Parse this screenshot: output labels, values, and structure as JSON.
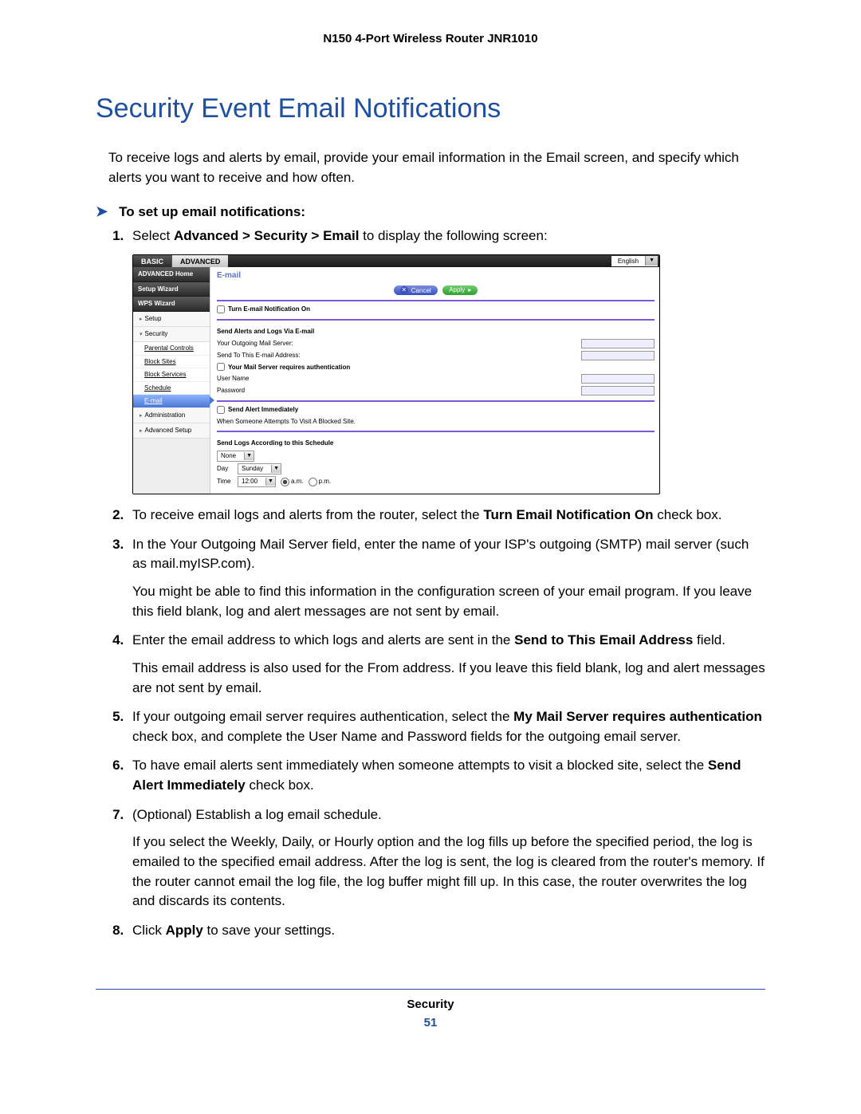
{
  "header": {
    "product": "N150 4-Port Wireless Router JNR1010"
  },
  "title": "Security Event Email Notifications",
  "intro": "To receive logs and alerts by email, provide your email information in the Email screen, and specify which alerts you want to receive and how often.",
  "howto": "To set up email notifications:",
  "steps": {
    "s1_a": "Select ",
    "s1_b": "Advanced > Security > Email",
    "s1_c": " to display the following screen:",
    "s2_a": "To receive email logs and alerts from the router, select the ",
    "s2_b": "Turn Email Notification On",
    "s2_c": " check box.",
    "s3": "In the Your Outgoing Mail Server field, enter the name of your ISP's outgoing (SMTP) mail server (such as mail.myISP.com).",
    "s3_p": "You might be able to find this information in the configuration screen of your email program. If you leave this field blank, log and alert messages are not sent by email.",
    "s4_a": "Enter the email address to which logs and alerts are sent in the ",
    "s4_b": "Send to This Email Address",
    "s4_c": " field.",
    "s4_p": "This email address is also used for the From address. If you leave this field blank, log and alert messages are not sent by email.",
    "s5_a": "If your outgoing email server requires authentication, select the ",
    "s5_b": "My Mail Server requires authentication",
    "s5_c": " check box, and complete the User Name and Password fields for the outgoing email server.",
    "s6_a": "To have email alerts sent immediately when someone attempts to visit a blocked site, select the ",
    "s6_b": "Send Alert Immediately",
    "s6_c": " check box.",
    "s7": "(Optional) Establish a log email schedule.",
    "s7_p": "If you select the Weekly, Daily, or Hourly option and the log fills up before the specified period, the log is emailed to the specified email address. After the log is sent, the log is cleared from the router's memory. If the router cannot email the log file, the log buffer might fill up. In this case, the router overwrites the log and discards its contents.",
    "s8_a": "Click ",
    "s8_b": "Apply",
    "s8_c": " to save your settings."
  },
  "ui": {
    "tabs": {
      "basic": "BASIC",
      "advanced": "ADVANCED"
    },
    "lang": "English",
    "sidebar": {
      "adv_home": "ADVANCED Home",
      "setup_wizard": "Setup Wizard",
      "wps_wizard": "WPS Wizard",
      "setup": "Setup",
      "security": "Security",
      "subs": {
        "parental": "Parental Controls",
        "block_sites": "Block Sites",
        "block_services": "Block Services",
        "schedule": "Schedule",
        "email": "E-mail"
      },
      "admin": "Administration",
      "adv_setup": "Advanced Setup"
    },
    "main": {
      "title": "E-mail",
      "cancel": "Cancel",
      "apply": "Apply",
      "notif_on": "Turn E-mail Notification On",
      "sec_alerts": "Send Alerts and Logs Via E-mail",
      "outgoing": "Your Outgoing Mail Server:",
      "send_to": "Send To This E-mail Address:",
      "auth_req": "Your Mail Server requires authentication",
      "user": "User Name",
      "pass": "Password",
      "alert_imm": "Send Alert Immediately",
      "alert_when": "When Someone Attempts To Visit A Blocked Site.",
      "sched_title": "Send Logs According to this Schedule",
      "sched_sel": "None",
      "day_lbl": "Day",
      "day_sel": "Sunday",
      "time_lbl": "Time",
      "time_sel": "12:00",
      "am": "a.m.",
      "pm": "p.m."
    }
  },
  "footer": {
    "section": "Security",
    "page": "51"
  }
}
